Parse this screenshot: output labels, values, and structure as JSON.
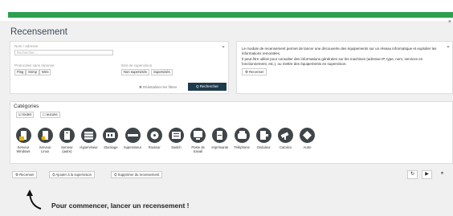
{
  "page": {
    "title": "Recensement",
    "close_glyph": "×"
  },
  "filters": {
    "name_label": "Nom / adresse",
    "name_placeholder": "Rechercher...",
    "probes_label": "Protocoles sans réponse",
    "probes": [
      "Ping",
      "Snmp",
      "Wmi"
    ],
    "supervision_label": "État de supervision",
    "supervision_options": [
      "Non supervisés",
      "Supervisés"
    ],
    "reset_label": "✖ Réinitialiser les filtres",
    "search_label": "Q Rechercher"
  },
  "info": {
    "line1": "Le module de recensement permet de lancer une découverte des équipements sur un réseau informatique et exploiter les informations remontées.",
    "line2": "Il peut être utilisé pour consulter des informations générales sur les machines (adresse IP, type, nom, services en fonctionnement, etc.), ou mettre des équipements en supervision.",
    "button": "Recenser"
  },
  "categories": {
    "title": "Catégories",
    "toggle_all": "toutes",
    "toggle_none": "aucune",
    "items": [
      {
        "label": "Serveur Windows",
        "icon": "windows-server-icon"
      },
      {
        "label": "Serveur Linux",
        "icon": "linux-server-icon"
      },
      {
        "label": "Serveur (autre)",
        "icon": "server-other-icon"
      },
      {
        "label": "Hyperviseur",
        "icon": "hypervisor-icon"
      },
      {
        "label": "Stockage",
        "icon": "storage-icon"
      },
      {
        "label": "Superviseur",
        "icon": "supervisor-icon"
      },
      {
        "label": "Routeur",
        "icon": "router-icon"
      },
      {
        "label": "Switch",
        "icon": "switch-icon"
      },
      {
        "label": "Poste de travail",
        "icon": "workstation-icon"
      },
      {
        "label": "Imprimante",
        "icon": "printer-icon"
      },
      {
        "label": "Téléphone",
        "icon": "phone-icon"
      },
      {
        "label": "Onduleur",
        "icon": "ups-icon"
      },
      {
        "label": "Caméra",
        "icon": "camera-icon"
      },
      {
        "label": "Autre",
        "icon": "other-icon"
      }
    ]
  },
  "toolbar": {
    "recenser": "Recenser",
    "add_supervision": "Ajouter à la supervision",
    "remove_recensement": "Supprimer du recensement",
    "refresh_icon": "refresh-icon",
    "play_icon": "play-icon",
    "pause_icon": "pause-icon"
  },
  "empty_state": {
    "message": "Pour commencer, lancer un recensement !"
  },
  "colors": {
    "accent_green": "#2e9e4f",
    "dark_button": "#1e3b4d",
    "category_circle": "#3f4548"
  }
}
